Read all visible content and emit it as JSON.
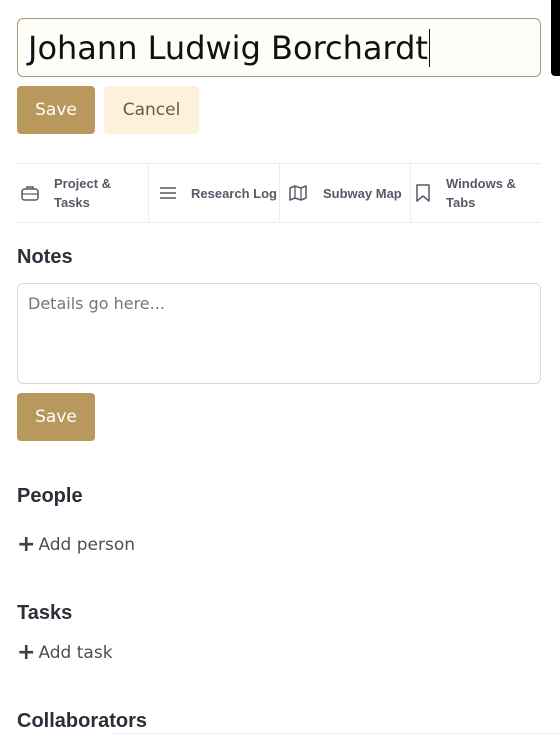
{
  "title_input": {
    "value": "Johann Ludwig Borchardt"
  },
  "title_actions": {
    "save_label": "Save",
    "cancel_label": "Cancel"
  },
  "tabs": [
    {
      "label": "Project & Tasks",
      "icon": "briefcase-icon"
    },
    {
      "label": "Research Log",
      "icon": "menu-lines-icon"
    },
    {
      "label": "Subway Map",
      "icon": "map-icon"
    },
    {
      "label": "Windows & Tabs",
      "icon": "bookmark-icon"
    }
  ],
  "notes": {
    "heading": "Notes",
    "placeholder": "Details go here...",
    "value": "",
    "save_label": "Save"
  },
  "people": {
    "heading": "People",
    "add_label": "Add person",
    "add_icon": "plus-icon"
  },
  "tasks": {
    "heading": "Tasks",
    "add_label": "Add task",
    "add_icon": "plus-icon"
  },
  "collaborators": {
    "heading": "Collaborators"
  },
  "colors": {
    "primary_button": "#b8985d",
    "secondary_button": "#fdf0dc",
    "heading_text": "#2b2f3a"
  }
}
